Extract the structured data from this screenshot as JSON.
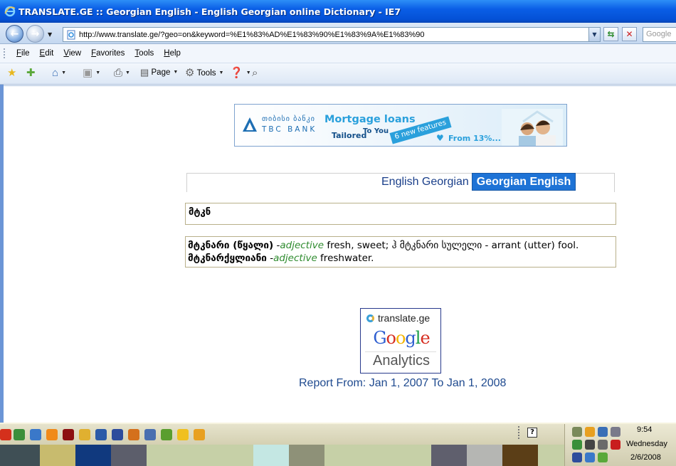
{
  "window": {
    "title": "TRANSLATE.GE :: Georgian English - English Georgian online Dictionary - IE7"
  },
  "navbar": {
    "url": "http://www.translate.ge/?geo=on&keyword=%E1%83%AD%E1%83%90%E1%83%9A%E1%83%90",
    "search_placeholder": "Google"
  },
  "menubar": {
    "items": [
      "File",
      "Edit",
      "View",
      "Favorites",
      "Tools",
      "Help"
    ]
  },
  "commandbar": {
    "page_label": "Page",
    "tools_label": "Tools"
  },
  "banner": {
    "bank_geo": "თიბისი ბანკი",
    "bank_name": "TBC BANK",
    "headline": "Mortgage loans",
    "tailored": "Tailored",
    "to_you": "To You",
    "ribbon": "6 new features",
    "from": "From 13%..."
  },
  "tabs": {
    "english_georgian": "English Georgian",
    "georgian_english": "Georgian English"
  },
  "search": {
    "value": "მტკნ"
  },
  "results": [
    {
      "term": "მტკნარი (წყალი)",
      "sep": " -",
      "pos": "adjective",
      "definition": " fresh, sweet; ჰ მტკნარი სულელი - arrant (utter) fool."
    },
    {
      "term": "მტკნარქყლიანი",
      "sep": " -",
      "pos": "adjective",
      "definition": " freshwater."
    }
  ],
  "analytics": {
    "brand": "translate.ge",
    "google": "Google",
    "analytics": "Analytics",
    "report": "Report From: Jan 1, 2007 To Jan 1, 2008"
  },
  "taskbar": {
    "time": "9:54",
    "day": "Wednesday",
    "date": "2/6/2008",
    "swatch_colors": [
      "#3f4f55",
      "#c8bb6e",
      "#10397e",
      "#5c5e6b",
      "#c6d0a7",
      "#c4e7e3",
      "#8e9178",
      "#c6d0a7",
      "#5f5f6d",
      "#b5b6b3",
      "#5b3e17",
      "#c6d0a7"
    ]
  }
}
